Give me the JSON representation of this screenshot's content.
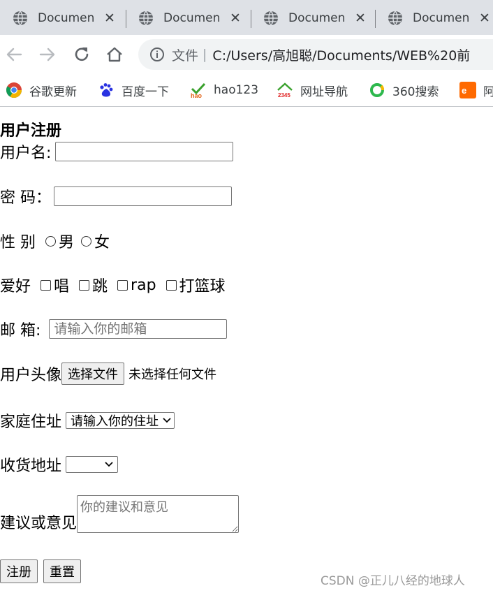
{
  "browser": {
    "tabs": [
      {
        "title": "Documen",
        "close": "✕"
      },
      {
        "title": "Documen",
        "close": "✕"
      },
      {
        "title": "Documen",
        "close": "✕"
      },
      {
        "title": "Documen",
        "close": "✕"
      }
    ],
    "address_chip": "文件",
    "address_separator": "|",
    "url": "C:/Users/高旭聪/Documents/WEB%20前",
    "bookmarks": [
      {
        "label": "谷歌更新",
        "icon": "chrome-icon"
      },
      {
        "label": "百度一下",
        "icon": "baidu-icon"
      },
      {
        "label": "hao123",
        "icon": "hao123-icon"
      },
      {
        "label": "网址导航",
        "icon": "2345-icon"
      },
      {
        "label": "360搜索",
        "icon": "360-icon"
      },
      {
        "label": "阿",
        "icon": "alibaba-icon"
      }
    ]
  },
  "form": {
    "title": "用户注册",
    "username_label": "用户名:",
    "username_value": "",
    "password_label": "密 码：",
    "password_value": "",
    "gender_label": "性 别",
    "gender_options": [
      "男",
      "女"
    ],
    "hobby_label": "爱好",
    "hobby_options": [
      "唱",
      "跳",
      "rap",
      "打篮球"
    ],
    "email_label": "邮 箱:",
    "email_placeholder": "请输入你的邮箱",
    "avatar_label": "用户头像",
    "avatar_button": "选择文件",
    "avatar_status": "未选择任何文件",
    "address_label": "家庭住址",
    "address_selected": "请输入你的住址",
    "shipping_label": "收货地址",
    "shipping_selected": "",
    "feedback_label": "建议或意见",
    "feedback_placeholder": "你的建议和意见",
    "submit_label": "注册",
    "reset_label": "重置"
  },
  "watermark": "CSDN @正儿八经的地球人"
}
